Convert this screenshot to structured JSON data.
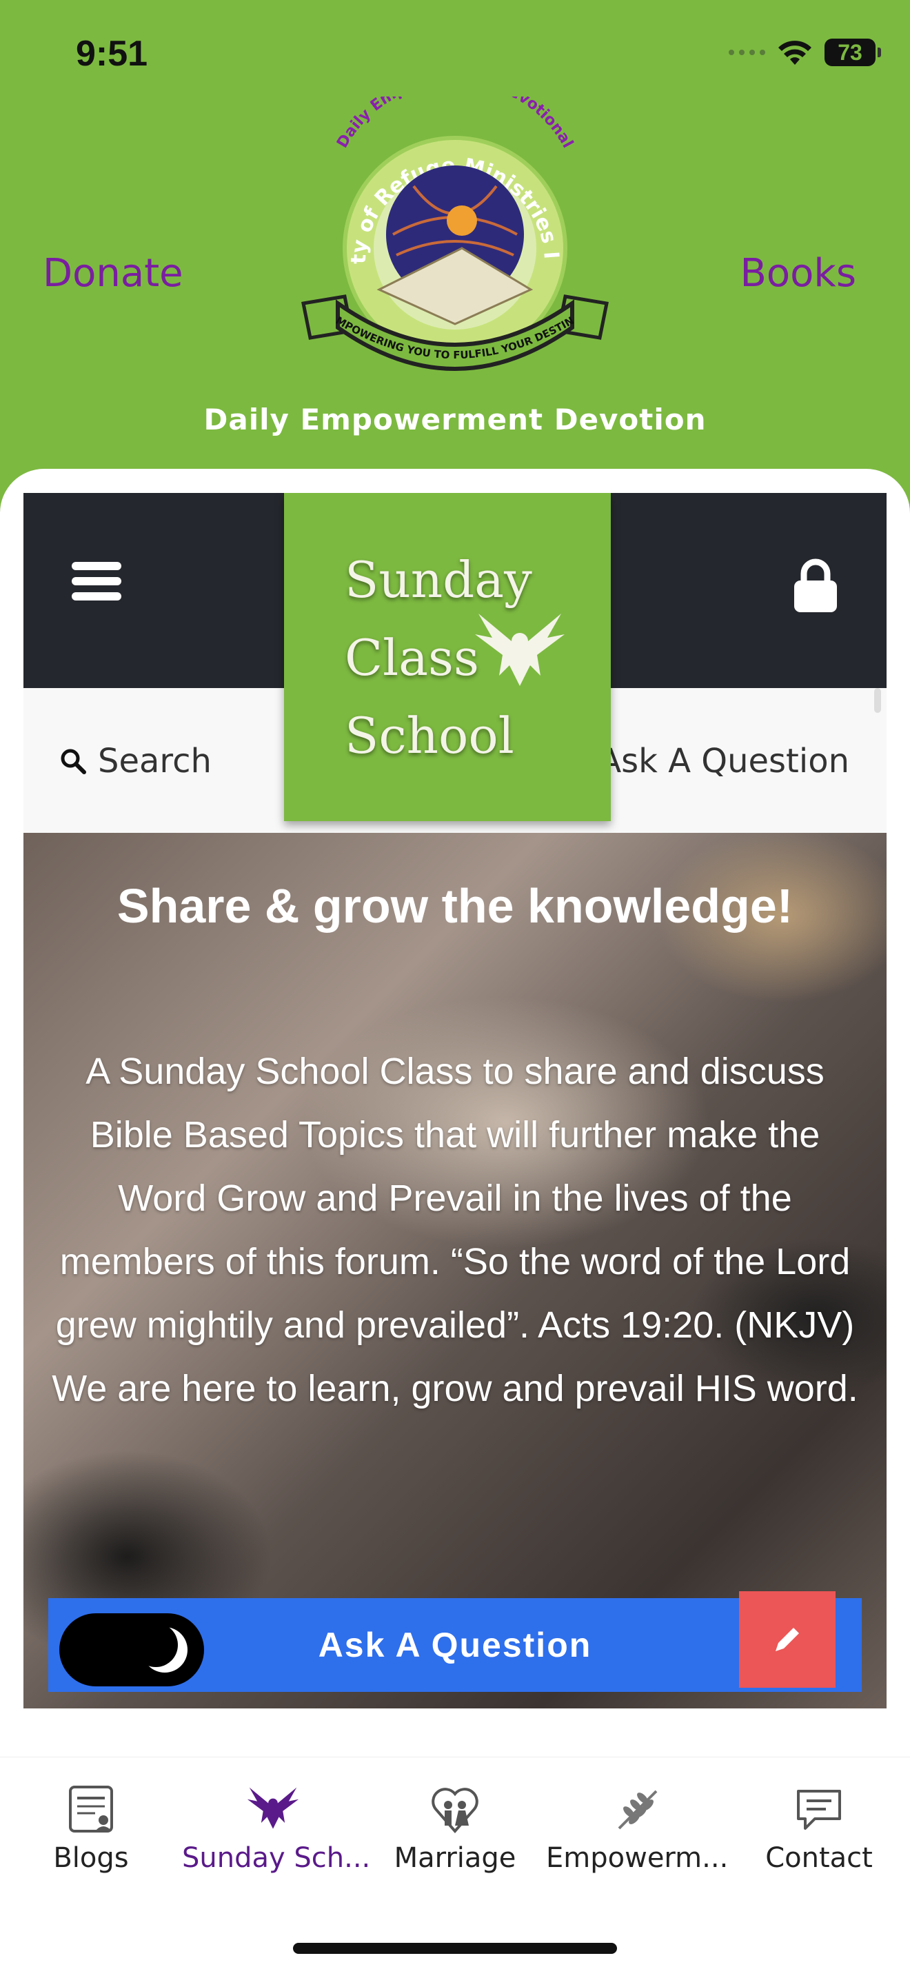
{
  "status": {
    "time": "9:51",
    "battery": "73"
  },
  "header": {
    "donate": "Donate",
    "books": "Books",
    "subtitle": "Daily Empowerment Devotion",
    "logo": {
      "arc_text": "Daily Empowerment Devotional",
      "ring_text": "City of Refuge Ministries Inc",
      "ribbon_text": "EMPOWERING YOU TO FULFILL YOUR DESTINY"
    }
  },
  "site": {
    "logo_lines": [
      "Sunday",
      "Class",
      "School"
    ],
    "search_label": "Search",
    "ask_link": "Ask A Question",
    "hero_title": "Share & grow the knowledge!",
    "hero_body": "A Sunday School Class to share and discuss Bible Based Topics that will further make the Word Grow and Prevail in the lives of the members of this forum. “So the word of the Lord grew mightily and prevailed”. Acts 19:20. (NKJV) We are here to learn, grow and prevail HIS word.",
    "ask_button": "Ask A Question"
  },
  "colors": {
    "brand_green": "#7cb940",
    "brand_purple": "#7a1ea1",
    "nav_dark": "#25272e",
    "button_blue": "#2e6fec",
    "edit_red": "#ec5656"
  },
  "tabs": [
    {
      "label": "Blogs",
      "icon": "blog-icon",
      "active": false
    },
    {
      "label": "Sunday Sch...",
      "icon": "eagle-icon",
      "active": true
    },
    {
      "label": "Marriage",
      "icon": "couple-heart-icon",
      "active": false
    },
    {
      "label": "Empowerm...",
      "icon": "leaf-icon",
      "active": false
    },
    {
      "label": "Contact",
      "icon": "chat-icon",
      "active": false
    }
  ]
}
